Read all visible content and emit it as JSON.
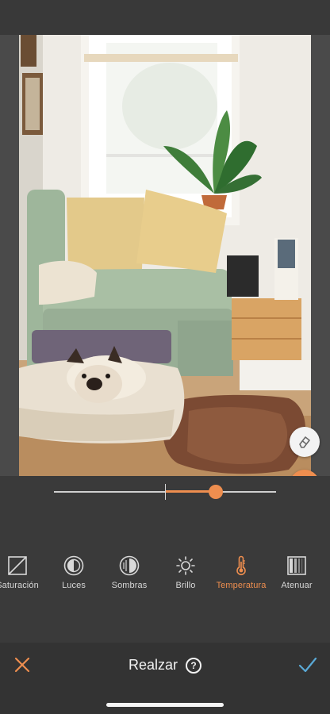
{
  "editor": {
    "title": "Realzar",
    "help_glyph": "?",
    "cancel_icon": "close-icon",
    "confirm_icon": "checkmark-icon"
  },
  "photo": {
    "description_icon": "photo-canvas",
    "eraser_icon": "eraser-icon",
    "compare_icon": "compare-split-icon"
  },
  "slider": {
    "value_fraction": 0.73,
    "center_fraction": 0.5
  },
  "tools": [
    {
      "label": "Saturación",
      "icon": "saturation-icon",
      "active": false
    },
    {
      "label": "Luces",
      "icon": "highlights-icon",
      "active": false
    },
    {
      "label": "Sombras",
      "icon": "shadows-icon",
      "active": false
    },
    {
      "label": "Brillo",
      "icon": "brightness-icon",
      "active": false
    },
    {
      "label": "Temperatura",
      "icon": "temperature-icon",
      "active": true
    },
    {
      "label": "Atenuar",
      "icon": "fade-icon",
      "active": false
    }
  ],
  "colors": {
    "accent": "#ee8e4f",
    "checkmark": "#5aa9d6",
    "toolbar_bg": "#3a3a3a",
    "bottombar_bg": "#333333"
  }
}
